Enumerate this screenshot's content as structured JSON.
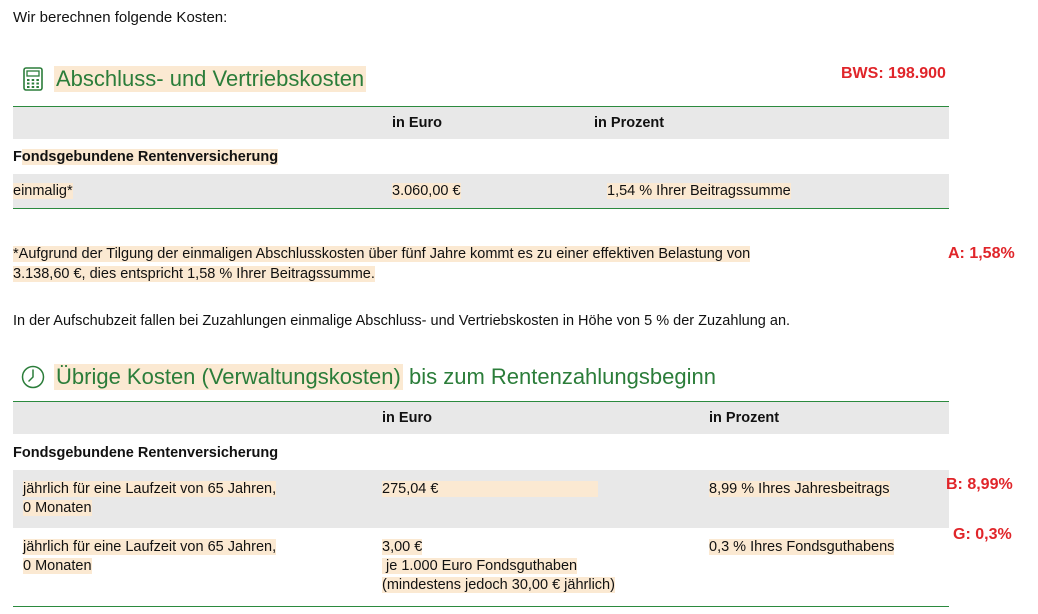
{
  "intro": "Wir berechnen folgende Kosten:",
  "badges": {
    "bws": "BWS: 198.900",
    "a": "A: 1,58%",
    "b": "B: 8,99%",
    "g": "G: 0,3%"
  },
  "section1": {
    "title": "Abschluss- und Vertriebskosten",
    "icon": "calculator-icon",
    "header": {
      "col1": "",
      "col2": "in Euro",
      "col3": "in Prozent"
    },
    "group_label_first": "F",
    "group_label_rest": "ondsgebundene Rentenversicherung",
    "rows": [
      {
        "label": "einmalig*",
        "euro": "3.060,00 €",
        "percent": "1,54 % Ihrer Beitragssumme"
      }
    ]
  },
  "footnote_line1": "*Aufgrund der Tilgung der einmaligen Abschlusskosten über fünf Jahre kommt es zu einer effektiven Belastung von",
  "footnote_line2": "3.138,60 €, dies entspricht 1,58 % Ihrer Beitragssumme.",
  "additional_note": "In der Aufschubzeit fallen bei Zuzahlungen einmalige Abschluss- und Vertriebskosten in Höhe von 5 % der Zuzahlung an.",
  "section2": {
    "title_highlight": "Übrige Kosten (Verwaltungskosten)",
    "title_rest": " bis zum Rentenzahlungsbeginn",
    "icon": "clock-icon",
    "header": {
      "col1": "",
      "col2": "in Euro",
      "col3": "in Prozent"
    },
    "group_label": "Fondsgebundene Rentenversicherung",
    "rows": [
      {
        "label_line1": "jährlich für eine Laufzeit von 65 Jahren,",
        "label_line2": "0 Monaten",
        "euro_line1": "275,04 €",
        "percent": "8,99 % Ihres Jahresbeitrags"
      },
      {
        "label_line1": "jährlich für eine Laufzeit von 65 Jahren,",
        "label_line2": "0 Monaten",
        "euro_line1": "3,00 €",
        "euro_line2": " je 1.000 Euro Fondsguthaben",
        "euro_line3": "(mindestens jedoch 30,00 € jährlich)",
        "percent": "0,3 % Ihres Fondsguthabens"
      }
    ]
  }
}
